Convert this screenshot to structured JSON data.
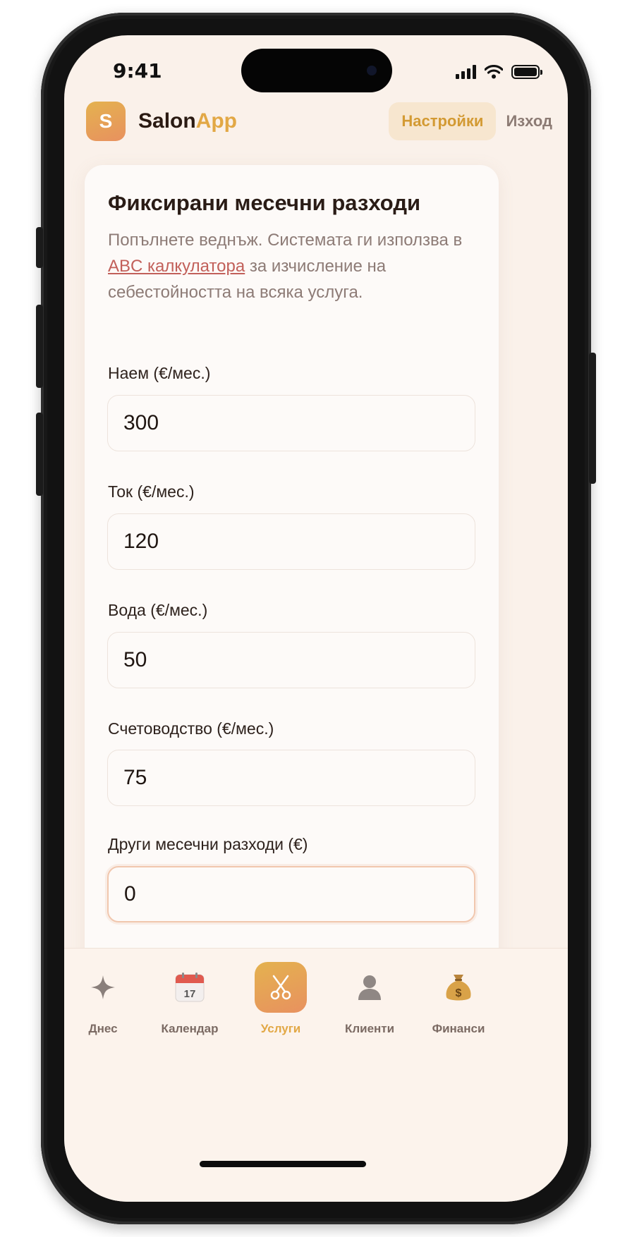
{
  "status_bar": {
    "time": "9:41"
  },
  "header": {
    "logo_letter": "S",
    "brand_part1": "Salon",
    "brand_part2": "App",
    "settings_label": "Настройки",
    "logout_label": "Изход"
  },
  "card": {
    "title": "Фиксирани месечни разходи",
    "description_before": "Попълнете веднъж. Системата ги използва в ",
    "description_link": "ABC калкулатора",
    "description_after": " за изчисление на себестойността на всяка услуга.",
    "fields": [
      {
        "label": "Наем (€/мес.)",
        "value": "300"
      },
      {
        "label": "Ток (€/мес.)",
        "value": "120"
      },
      {
        "label": "Вода (€/мес.)",
        "value": "50"
      },
      {
        "label": "Счетоводство (€/мес.)",
        "value": "75"
      },
      {
        "label": "Други месечни разходи (€)",
        "value": "0"
      }
    ]
  },
  "tabs": [
    {
      "label": "Днес",
      "icon": "sparkle-icon"
    },
    {
      "label": "Календар",
      "icon": "calendar-icon",
      "icon_text": "17"
    },
    {
      "label": "Услуги",
      "icon": "scissors-icon",
      "active": true
    },
    {
      "label": "Клиенти",
      "icon": "person-icon"
    },
    {
      "label": "Финанси",
      "icon": "money-bag-icon",
      "icon_text": "$"
    }
  ],
  "colors": {
    "accent": "#e2a845",
    "link": "#c2605a",
    "background": "#faf1ea"
  }
}
